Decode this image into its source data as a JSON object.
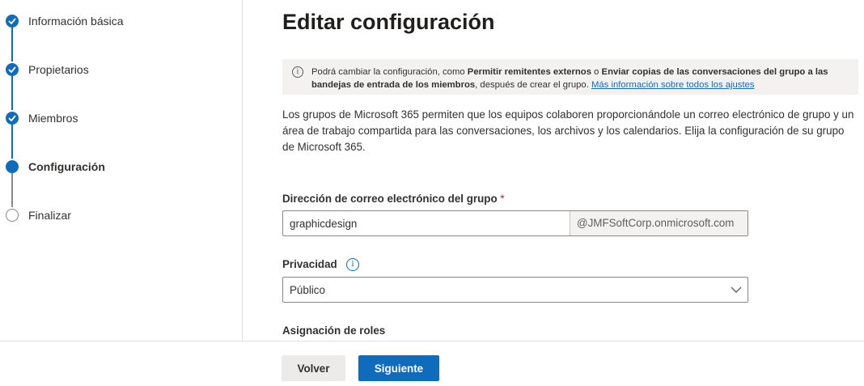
{
  "stepper": {
    "steps": [
      {
        "label": "Información básica",
        "state": "done"
      },
      {
        "label": "Propietarios",
        "state": "done"
      },
      {
        "label": "Miembros",
        "state": "done"
      },
      {
        "label": "Configuración",
        "state": "current"
      },
      {
        "label": "Finalizar",
        "state": "todo"
      }
    ]
  },
  "main": {
    "title": "Editar configuración",
    "notice": {
      "part1": "Podrá cambiar la configuración, como ",
      "bold1": "Permitir remitentes externos",
      "part2": " o ",
      "bold2": "Enviar copias de las conversaciones del grupo a las bandejas de entrada de los miembros",
      "part3": ", después de crear el grupo. ",
      "link": "Más información sobre todos los ajustes"
    },
    "description": "Los grupos de Microsoft 365 permiten que los equipos colaboren proporcionándole un correo electrónico de grupo y un área de trabajo compartida para las conversaciones, los archivos y los calendarios. Elija la configuración de su grupo de Microsoft 365.",
    "email": {
      "label": "Dirección de correo electrónico del grupo",
      "required_mark": "*",
      "value": "graphicdesign",
      "domain_suffix": "@JMFSoftCorp.onmicrosoft.com"
    },
    "privacy": {
      "label": "Privacidad",
      "selected": "Público"
    },
    "roles": {
      "label": "Asignación de roles"
    }
  },
  "footer": {
    "back_label": "Volver",
    "next_label": "Siguiente"
  },
  "colors": {
    "accent": "#0f6cbd",
    "required": "#a4262c",
    "notice_bg": "#f3f2f1"
  }
}
